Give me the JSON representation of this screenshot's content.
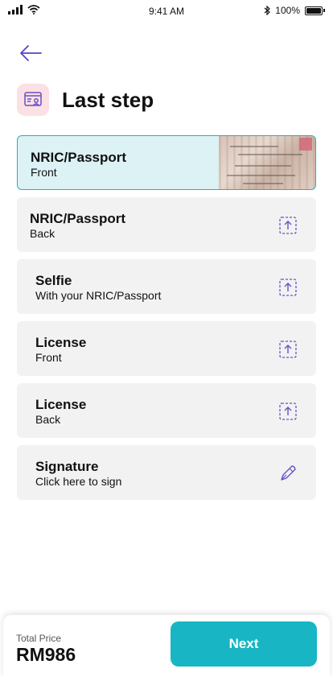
{
  "status_bar": {
    "time": "9:41 AM",
    "battery_text": "100%"
  },
  "header": {
    "title": "Last step",
    "icon": "id-document-icon"
  },
  "documents": [
    {
      "title": "NRIC/Passport",
      "subtitle": "Front",
      "state": "uploaded",
      "icon": "document-thumbnail"
    },
    {
      "title": "NRIC/Passport",
      "subtitle": "Back",
      "state": "pending",
      "icon": "upload-icon"
    },
    {
      "title": "Selfie",
      "subtitle": "With your NRIC/Passport",
      "state": "pending",
      "icon": "upload-icon"
    },
    {
      "title": "License",
      "subtitle": "Front",
      "state": "pending",
      "icon": "upload-icon"
    },
    {
      "title": "License",
      "subtitle": "Back",
      "state": "pending",
      "icon": "upload-icon"
    },
    {
      "title": "Signature",
      "subtitle": "Click here to sign",
      "state": "pending",
      "icon": "pen-icon"
    }
  ],
  "footer": {
    "total_label": "Total Price",
    "total_value": "RM986",
    "next_label": "Next"
  },
  "colors": {
    "accent": "#18b6c4",
    "active_card": "#dcf2f4",
    "card": "#f2f2f2",
    "icon_purple": "#6a4fc7",
    "header_icon_bg": "#fbe0e4"
  }
}
